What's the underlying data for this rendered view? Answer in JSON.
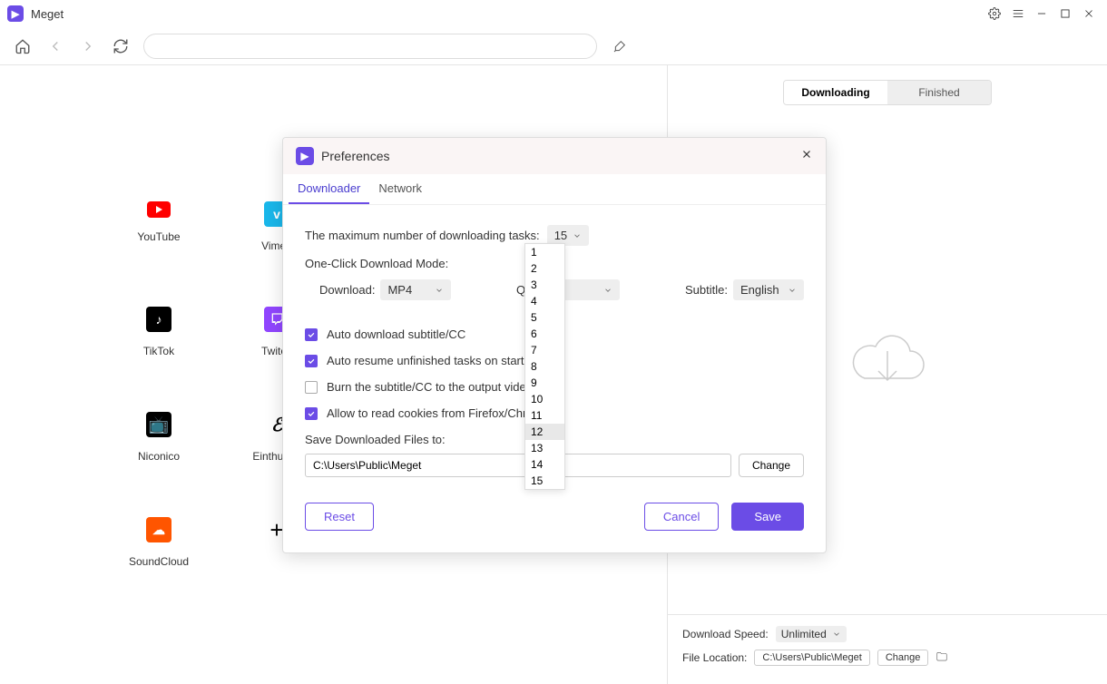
{
  "app": {
    "title": "Meget"
  },
  "right": {
    "tabs": {
      "downloading": "Downloading",
      "finished": "Finished"
    },
    "footer": {
      "speed_label": "Download Speed:",
      "speed_value": "Unlimited",
      "loc_label": "File Location:",
      "loc_value": "C:\\Users\\Public\\Meget",
      "change": "Change"
    }
  },
  "sites": [
    {
      "name": "YouTube"
    },
    {
      "name": "Vimeo"
    },
    {
      "name": "TikTok"
    },
    {
      "name": "Twitch"
    },
    {
      "name": "Niconico"
    },
    {
      "name": "Einthusan"
    },
    {
      "name": "SoundCloud"
    },
    {
      "name": ""
    }
  ],
  "prefs": {
    "title": "Preferences",
    "tabs": {
      "downloader": "Downloader",
      "network": "Network"
    },
    "max_tasks_label": "The maximum number of downloading tasks:",
    "max_tasks_value": "15",
    "mode_label": "One-Click Download Mode:",
    "download_label": "Download:",
    "download_value": "MP4",
    "quality_label": "Quali",
    "quality_value": "t",
    "subtitle_label": "Subtitle:",
    "subtitle_value": "English",
    "cb1": "Auto download subtitle/CC",
    "cb2": "Auto resume unfinished tasks on startup",
    "cb3": "Burn the subtitle/CC to the output video",
    "cb4": "Allow to read cookies from Firefox/Chrome",
    "save_label": "Save Downloaded Files to:",
    "save_path": "C:\\Users\\Public\\Meget",
    "change": "Change",
    "reset": "Reset",
    "cancel": "Cancel",
    "save": "Save",
    "dropdown_options": [
      "1",
      "2",
      "3",
      "4",
      "5",
      "6",
      "7",
      "8",
      "9",
      "10",
      "11",
      "12",
      "13",
      "14",
      "15"
    ],
    "dropdown_highlight": "12"
  }
}
